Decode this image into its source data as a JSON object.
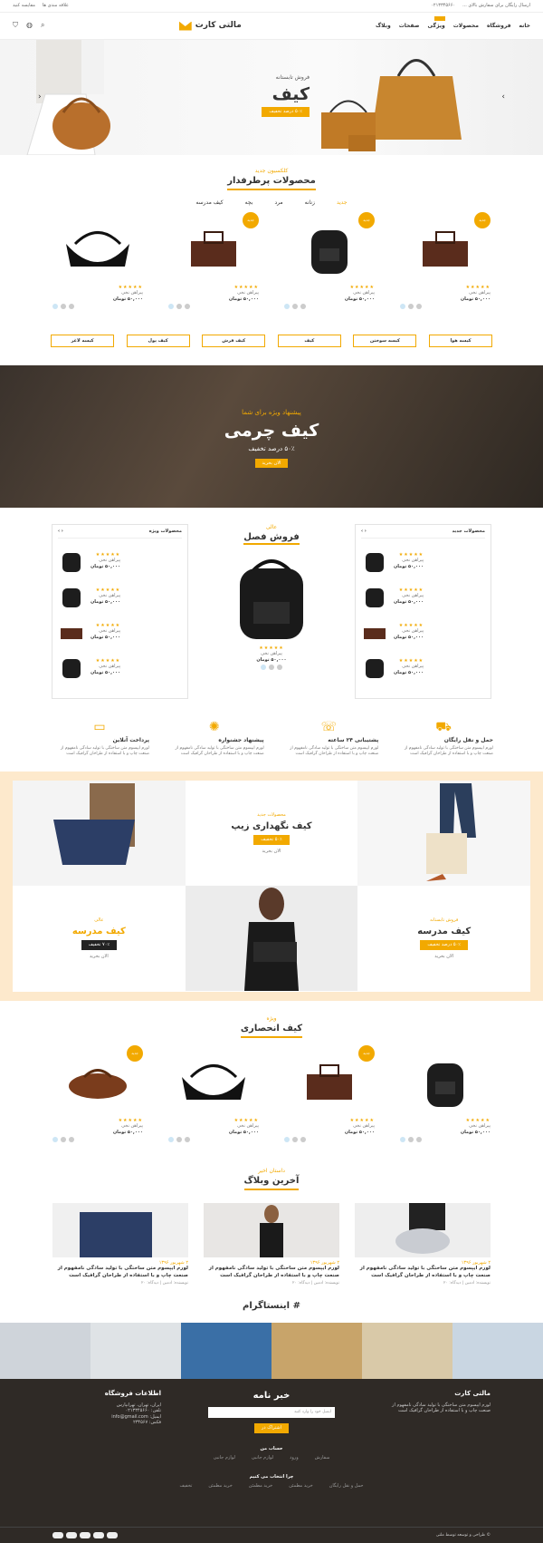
{
  "topbar": {
    "shipping": "ارسال رایگان برای سفارش بالای ...",
    "phone": "۰۲۱۳۳۴۵۶۶۰",
    "wishlist": "علاقه مندی ها",
    "compare": "مقایسه کنید"
  },
  "nav": {
    "logo": "مالتی کارت",
    "items": [
      "خانه",
      "فروشگاه",
      "محصولات",
      "ویژگی",
      "صفحات",
      "وبلاگ"
    ]
  },
  "hero": {
    "kicker": "فروش تابستانه",
    "title": "کیف",
    "cta": "۵۰٪ درصد تخفیف"
  },
  "featured": {
    "sub": "کلکسیون جدید",
    "title": "محصولات پرطرفدار",
    "tabs": [
      "جدید",
      "زنانه",
      "مرد",
      "بچه",
      "کیف مدرسه"
    ]
  },
  "products": [
    {
      "badge": "جدید",
      "name": "پیراهن نخی",
      "price": "۵۰,۰۰۰ تومان",
      "stars": "★★★★★"
    },
    {
      "badge": "جدید",
      "name": "پیراهن نخی",
      "price": "۵۰,۰۰۰ تومان",
      "stars": "★★★★★"
    },
    {
      "badge": "جدید",
      "name": "پیراهن نخی",
      "price": "۵۰,۰۰۰ تومان",
      "stars": "★★★★★"
    },
    {
      "badge": "",
      "name": "پیراهن نخی",
      "price": "۵۰,۰۰۰ تومان",
      "stars": "★★★★★"
    }
  ],
  "categories": [
    "کیسه هوا",
    "کیسه سوختن",
    "کیف",
    "کیف فرش",
    "کیف پول",
    "کیسه لاغر"
  ],
  "banner": {
    "kicker": "پیشنهاد ویژه برای شما",
    "title": "کیف چرمی",
    "discount": "۵۰٪ درصد تخفیف",
    "cta": "الان بخرید"
  },
  "new_box": {
    "title": "محصولات جدید"
  },
  "special_box": {
    "title": "محصولات ویژه"
  },
  "season": {
    "sub": "عالی",
    "title": "فروش فصل",
    "name": "پیراهن نخی",
    "price": "۵۰,۰۰۰ تومان"
  },
  "mini": {
    "name": "پیراهن نخی",
    "price": "۵۰,۰۰۰ تومان",
    "stars": "★★★★★"
  },
  "features": [
    {
      "title": "حمل و نقل رایگان",
      "text": "لورم ایپسوم متن ساختگی با تولید سادگی نامفهوم از صنعت چاپ و با استفاده از طراحان گرافیک است"
    },
    {
      "title": "پشتیبانی ۲۴ ساعته",
      "text": "لورم ایپسوم متن ساختگی با تولید سادگی نامفهوم از صنعت چاپ و با استفاده از طراحان گرافیک است"
    },
    {
      "title": "پیشنهاد جشنواره",
      "text": "لورم ایپسوم متن ساختگی با تولید سادگی نامفهوم از صنعت چاپ و با استفاده از طراحان گرافیک است"
    },
    {
      "title": "پرداخت آنلاین",
      "text": "لورم ایپسوم متن ساختگی با تولید سادگی نامفهوم از صنعت چاپ و با استفاده از طراحان گرافیک است"
    }
  ],
  "promo": {
    "zip": {
      "sub": "محصولات جدید",
      "title": "کیف نگهداری زیپ",
      "cta": "۵۰٪ تخفیف",
      "link": "الان بخرید"
    },
    "school": {
      "sub": "فروش تابستانه",
      "title": "کیف مدرسه",
      "cta": "۵۰٪ درصد تخفیف",
      "link": "الان بخرید"
    },
    "bag": {
      "sub": "عالی",
      "title": "کیف مدرسه",
      "cta": "۷۰٪ تخفیف",
      "link": "الان بخرید"
    }
  },
  "exclusive": {
    "sub": "ویژه",
    "title": "کیف انحصاری"
  },
  "blog": {
    "sub": "داستان اخیر",
    "title": "آخرین وبلاگ",
    "posts": [
      {
        "date": "۲ شهریور ۱۳۹۶",
        "title": "لورم ایپسوم متن ساختگی با تولید سادگی نامفهوم از صنعت چاپ و با استفاده از طراحان گرافیک است",
        "meta": "نویسنده: ادمین | دیدگاه: ۲۰"
      },
      {
        "date": "۲ شهریور ۱۳۹۶",
        "title": "لورم ایپسوم متن ساختگی با تولید سادگی نامفهوم از صنعت چاپ و با استفاده از طراحان گرافیک است",
        "meta": "نویسنده: ادمین | دیدگاه: ۲۰"
      },
      {
        "date": "۲ شهریور ۱۳۹۶",
        "title": "لورم ایپسوم متن ساختگی با تولید سادگی نامفهوم از صنعت چاپ و با استفاده از طراحان گرافیک است",
        "meta": "نویسنده: ادمین | دیدگاه: ۲۰"
      }
    ]
  },
  "instagram": {
    "title": "# اینستاگرام"
  },
  "footer": {
    "brand": "مالتی کارت",
    "about": "لورم ایپسوم متن ساختگی با تولید سادگی نامفهوم از صنعت چاپ و با استفاده از طراحان گرافیک است",
    "newsletter": "خبر نامه",
    "email_placeholder": "ایمیل خود را وارد کنید",
    "subscribe": "اشتراک در",
    "info_title": "اطلاعات فروشگاه",
    "info_lines": [
      "ایران، تهران، تهرانپارس",
      "تلفن: ۰۲۱۳۳۴۵۶۶۰",
      "ایمیل: info@gmail.com",
      "فکس: ۲۳۴۵۶۷"
    ],
    "account_title": "حساب من",
    "account_links": [
      "سفارش",
      "ورود",
      "لوازم جانبی",
      "لوازم جانبی"
    ],
    "why_title": "چرا انتخاب می کنیم",
    "why_links": [
      "حمل و نقل رایگان",
      "خرید مطمئن",
      "خرید مطمئن",
      "خرید مطمئن",
      "تخفیف"
    ],
    "copyright": "© طراحی و توسعه توسط ملتی"
  },
  "colors": {
    "accent": "#f2a900",
    "dark": "#2f2a26"
  }
}
